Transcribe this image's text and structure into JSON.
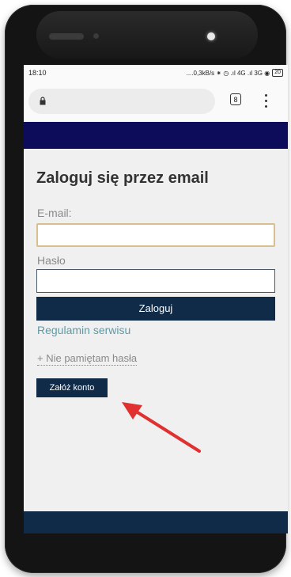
{
  "status_bar": {
    "time": "18:10",
    "indicators": "....0,3kB/s ⁕ ◷ .ıl 4G  .ıl 3G ◉",
    "battery": "20"
  },
  "browser": {
    "tab_count": "8"
  },
  "login": {
    "title": "Zaloguj się przez email",
    "email_label": "E-mail:",
    "email_value": "",
    "password_label": "Hasło",
    "password_value": "",
    "login_button": "Zaloguj",
    "terms_link": "Regulamin serwisu",
    "forgot_link": "+ Nie pamiętam hasła",
    "register_button": "Załóż konto"
  },
  "colors": {
    "top_band": "#0c0c5b",
    "button": "#0f2b48",
    "link": "#5d9aa6",
    "arrow": "#e03030",
    "email_focus_border": "#d8c08e"
  }
}
